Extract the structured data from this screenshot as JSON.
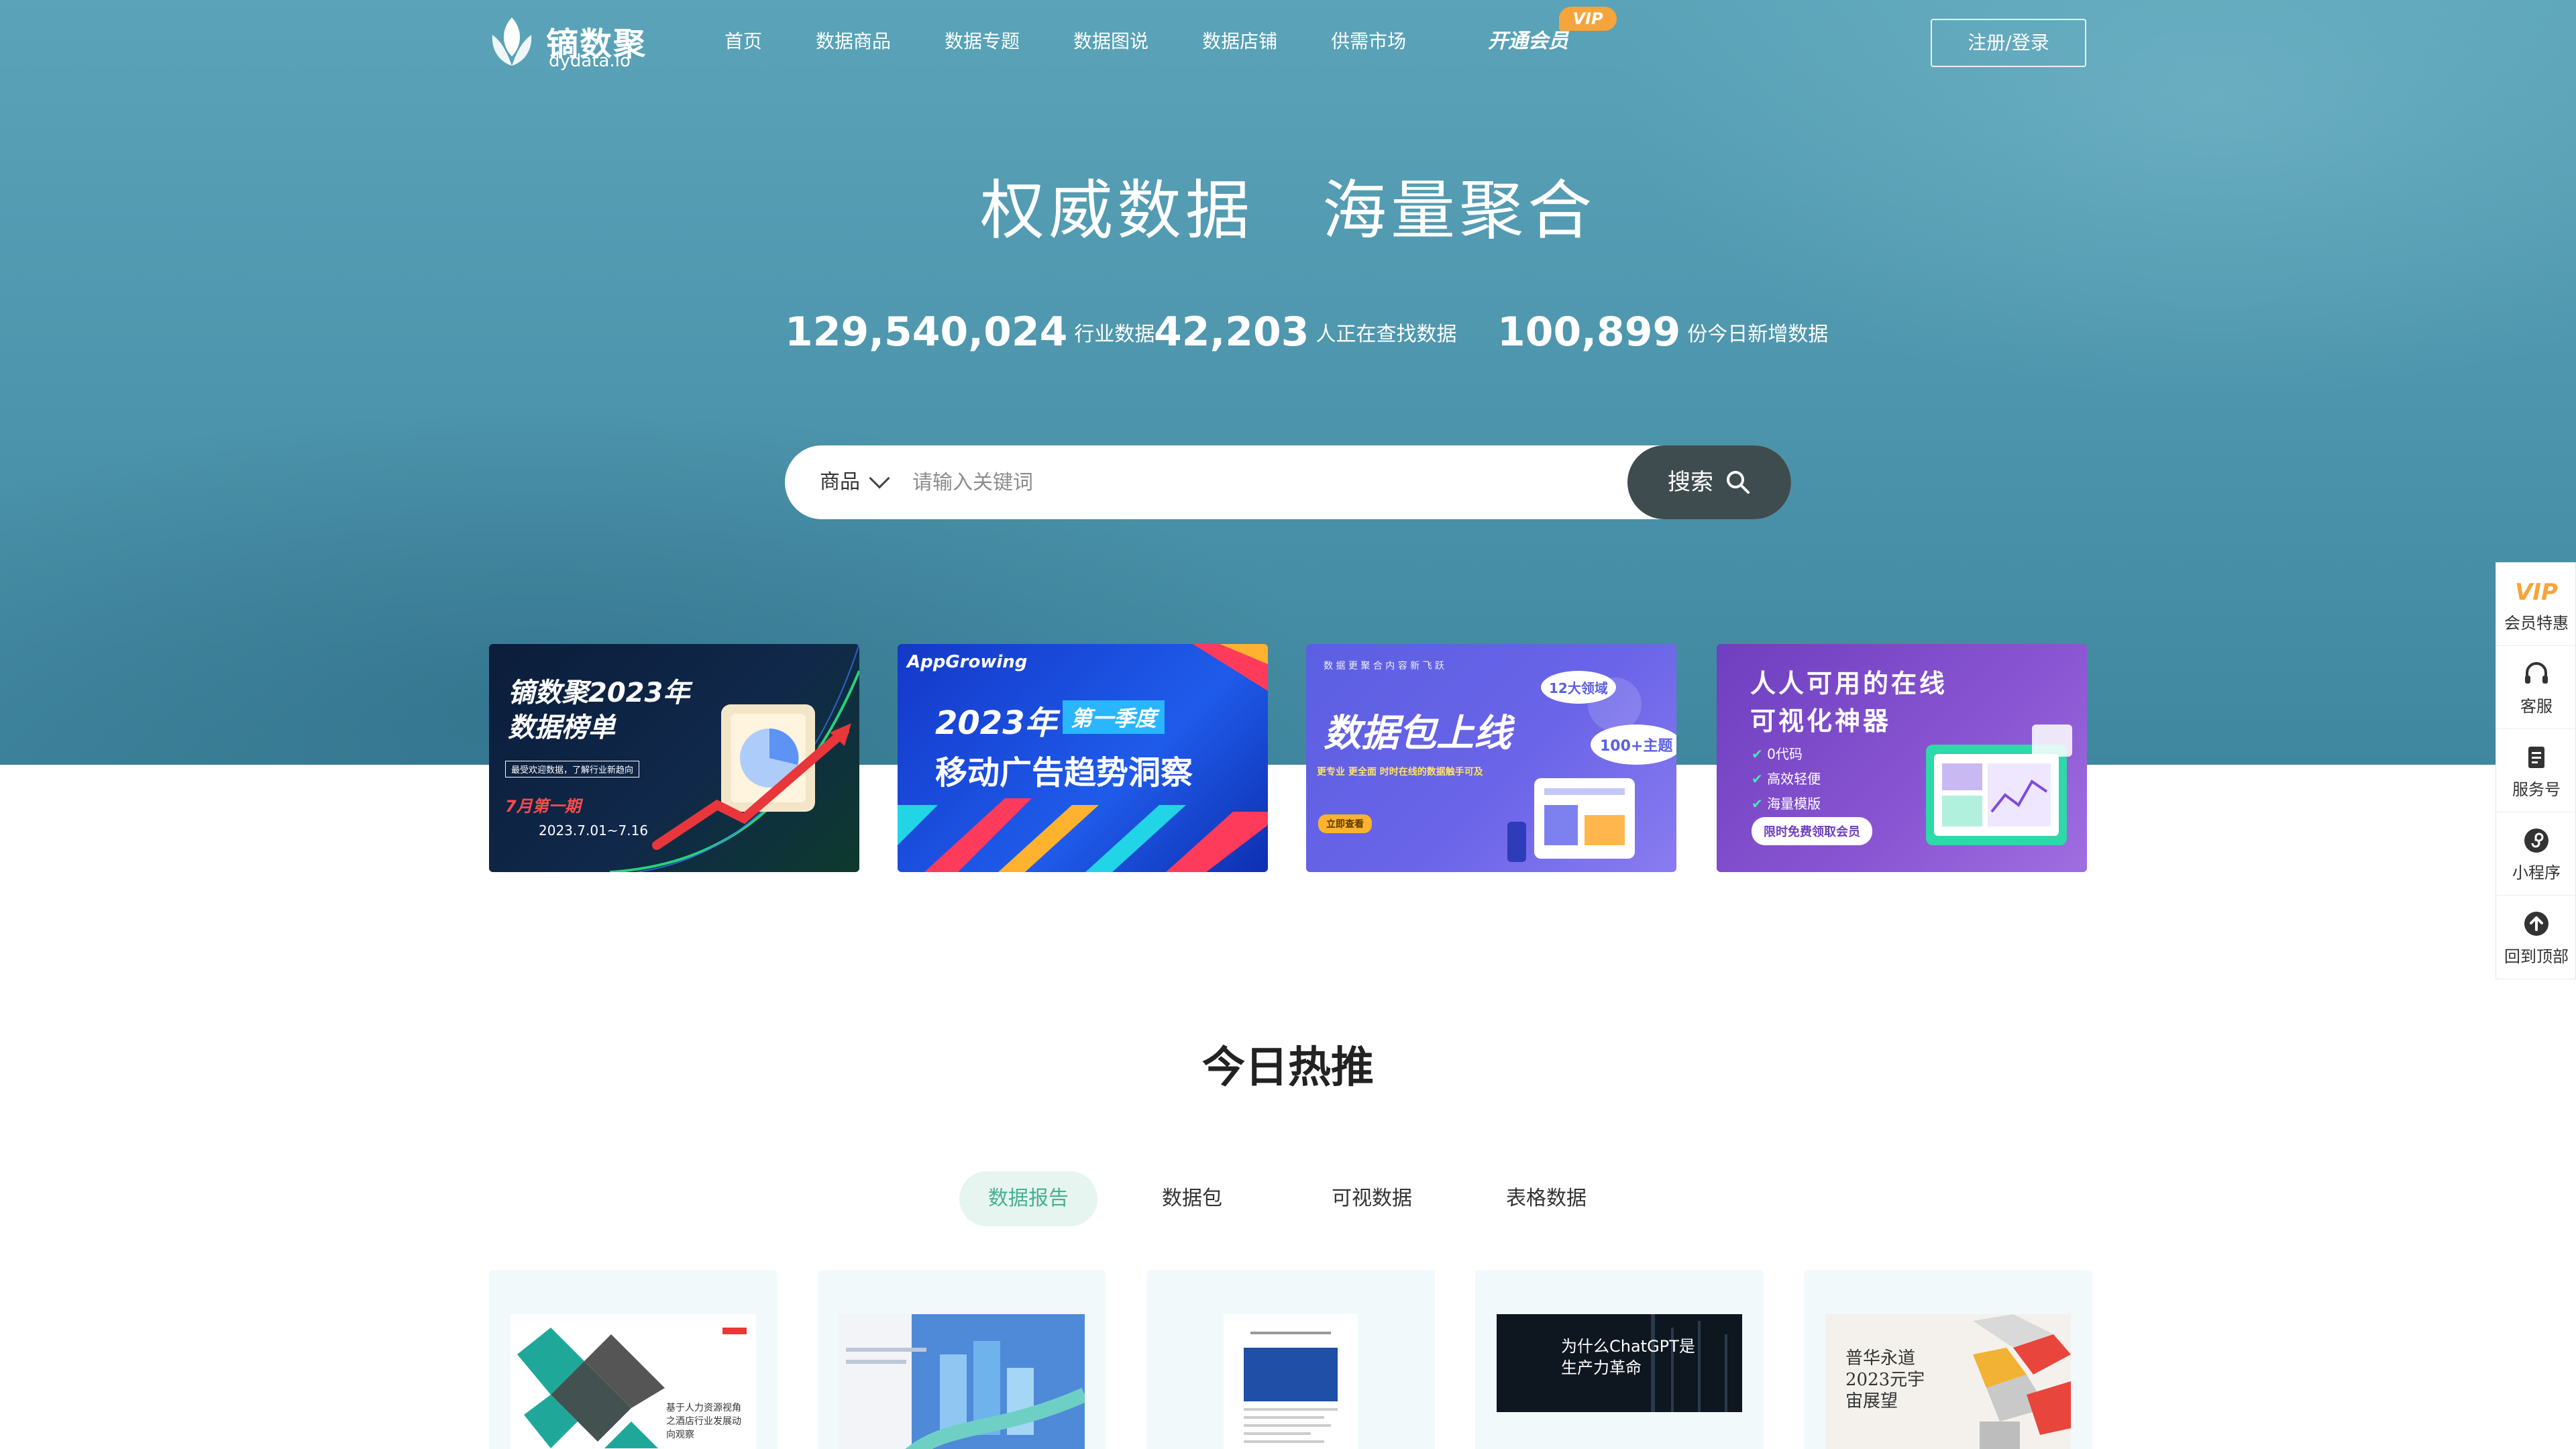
{
  "header": {
    "logo_text": "镝数聚",
    "logo_sub": "dydata.io",
    "nav": [
      "首页",
      "数据商品",
      "数据专题",
      "数据图说",
      "数据店铺",
      "供需市场"
    ],
    "vip_label": "开通会员",
    "vip_badge": "VIP",
    "login_label": "注册/登录"
  },
  "hero": {
    "title": "权威数据　海量聚合",
    "stats": [
      {
        "num": "129,540,024",
        "label": "行业数据"
      },
      {
        "num": "42,203",
        "label": "人正在查找数据"
      },
      {
        "num": "100,899",
        "label": "份今日新增数据"
      }
    ],
    "search": {
      "type": "商品",
      "placeholder": "请输入关键词",
      "button": "搜索"
    }
  },
  "banners": {
    "b1": {
      "line1": "镝数聚2023年",
      "line2": "数据榜单",
      "tag": "最受欢迎数据，了解行业新趋向",
      "issue": "7月第一期",
      "date": "2023.7.01~7.16"
    },
    "b2": {
      "brand": "AppGrowing",
      "year": "2023年",
      "quarter": "第一季度",
      "title": "移动广告趋势洞察"
    },
    "b3": {
      "top": "数 据 更 聚 合  内 容 新 飞 跃",
      "title": "数据包上线",
      "sub": "更专业 更全面 时时在线的数据触手可及",
      "btn": "立即查看",
      "bubble1": "12大领域",
      "bubble2": "100+主题"
    },
    "b4": {
      "line1": "人人可用的在线",
      "line2": "可视化神器",
      "f1": "0代码",
      "f2": "高效轻便",
      "f3": "海量模版",
      "btn": "限时免费领取会员"
    }
  },
  "sidebar": [
    {
      "icon": "vip-icon",
      "label": "会员特惠",
      "badge": "VIP"
    },
    {
      "icon": "headset-icon",
      "label": "客服"
    },
    {
      "icon": "document-icon",
      "label": "服务号"
    },
    {
      "icon": "mini-program-icon",
      "label": "小程序"
    },
    {
      "icon": "arrow-up-icon",
      "label": "回到顶部"
    }
  ],
  "hot": {
    "title": "今日热推",
    "tabs": [
      "数据报告",
      "数据包",
      "可视数据",
      "表格数据"
    ],
    "active_tab": "数据报告",
    "cards": [
      {
        "thumb_text": "基于人力资源视角之酒店行业发展动向观察"
      },
      {
        "thumb_text": ""
      },
      {
        "thumb_text": ""
      },
      {
        "thumb_text": "为什么ChatGPT是生产力革命"
      },
      {
        "thumb_text": "普华永道 2023元宇宙展望"
      }
    ]
  },
  "colors": {
    "hero_top": "#5aa3b8",
    "hero_bottom": "#3f879e",
    "search_button": "#3f4c4f",
    "accent_green": "#46b08f",
    "vip_orange": "#f7a43a"
  }
}
